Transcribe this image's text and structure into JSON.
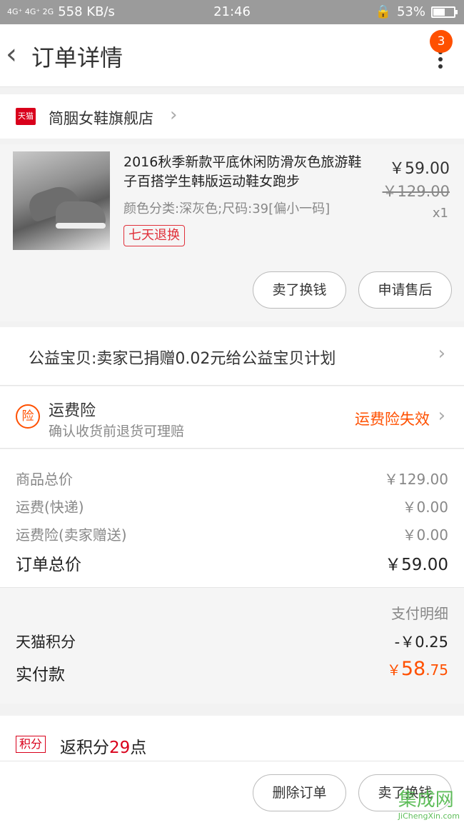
{
  "status_bar": {
    "network": "4G⁺ 4G⁺ 2G",
    "speed": "558 KB/s",
    "time": "21:46",
    "battery": "53%"
  },
  "navbar": {
    "back_icon": "chevron-left-icon",
    "title": "订单详情",
    "badge_count": "3",
    "more_icon": "more-vertical-icon"
  },
  "shop": {
    "icon_text": "天猫",
    "name": "简胭女鞋旗舰店"
  },
  "product": {
    "title": "2016秋季新款平底休闲防滑灰色旅游鞋子百搭学生韩版运动鞋女跑步",
    "sku": "颜色分类:深灰色;尺码:39[偏小一码]",
    "tag": "七天退换",
    "price": "￥59.00",
    "original_price": "￥129.00",
    "quantity": "x1",
    "btn_sell": "卖了换钱",
    "btn_after_sale": "申请售后"
  },
  "charity": {
    "text": "公益宝贝:卖家已捐赠0.02元给公益宝贝计划"
  },
  "insurance": {
    "icon_text": "险",
    "title": "运费险",
    "subtitle": "确认收货前退货可理赔",
    "status": "运费险失效"
  },
  "summary": {
    "goods_label": "商品总价",
    "goods_value": "￥129.00",
    "shipping_label": "运费(快递)",
    "shipping_value": "￥0.00",
    "insurance_label": "运费险(卖家赠送)",
    "insurance_value": "￥0.00",
    "total_label": "订单总价",
    "total_value": "￥59.00"
  },
  "payment": {
    "detail_label": "支付明细",
    "points_label": "天猫积分",
    "points_value": "-￥0.25",
    "actual_label": "实付款",
    "actual_currency": "￥",
    "actual_int": "58",
    "actual_dec": ".75"
  },
  "points": {
    "tag": "积分",
    "prefix": "返积分",
    "count": "29",
    "suffix": "点"
  },
  "bottom": {
    "btn_delete": "删除订单",
    "btn_sell": "卖了换钱"
  },
  "watermark": {
    "text": "集成网",
    "sub": "JiChengXin.com"
  },
  "colors": {
    "accent": "#ff5000",
    "tmall_red": "#d9001b",
    "tag_red": "#e0303a"
  }
}
